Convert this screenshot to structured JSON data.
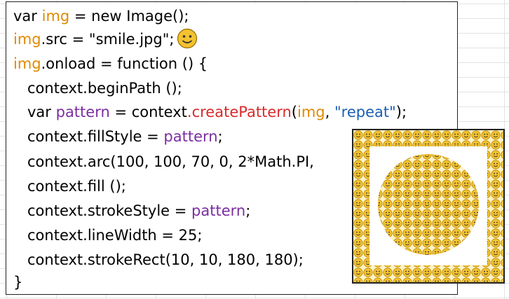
{
  "code_lines": [
    [
      {
        "text": "var ",
        "cls": ""
      },
      {
        "text": "img",
        "cls": "kw-orange"
      },
      {
        "text": " = new Image();",
        "cls": ""
      }
    ],
    [
      {
        "text": "img",
        "cls": "kw-orange"
      },
      {
        "text": ".src = \"smile.jpg\";",
        "cls": ""
      }
    ],
    [
      {
        "text": "img",
        "cls": "kw-orange"
      },
      {
        "text": ".onload = function () {",
        "cls": ""
      }
    ],
    [
      {
        "text": "context.beginPath ();",
        "cls": ""
      }
    ],
    [
      {
        "text": "var ",
        "cls": ""
      },
      {
        "text": "pattern",
        "cls": "kw-purple"
      },
      {
        "text": " = context",
        "cls": ""
      },
      {
        "text": ".",
        "cls": "dot-red"
      },
      {
        "text": "createPattern",
        "cls": "kw-red"
      },
      {
        "text": "(",
        "cls": ""
      },
      {
        "text": "img",
        "cls": "kw-orange"
      },
      {
        "text": ", ",
        "cls": ""
      },
      {
        "text": "\"repeat\"",
        "cls": "kw-blue"
      },
      {
        "text": ");",
        "cls": ""
      }
    ],
    [
      {
        "text": "context.fillStyle = ",
        "cls": ""
      },
      {
        "text": "pattern",
        "cls": "kw-purple"
      },
      {
        "text": ";",
        "cls": ""
      }
    ],
    [
      {
        "text": "context.arc(100, 100, 70, 0, 2*Math.PI,",
        "cls": ""
      }
    ],
    [
      {
        "text": "context.fill ();",
        "cls": ""
      }
    ],
    [
      {
        "text": "context.strokeStyle = ",
        "cls": ""
      },
      {
        "text": "pattern",
        "cls": "kw-purple"
      },
      {
        "text": ";",
        "cls": ""
      }
    ],
    [
      {
        "text": "context.lineWidth = 25;",
        "cls": ""
      }
    ],
    [
      {
        "text": "context.strokeRect(10, 10, 180, 180);",
        "cls": ""
      }
    ],
    [
      {
        "text": "}",
        "cls": ""
      }
    ]
  ],
  "indented_lines": [
    3,
    4,
    5,
    6,
    7,
    8,
    9,
    10
  ],
  "smiley_icon": "smiley-face-icon",
  "colors": {
    "variable_img": "#e08a00",
    "variable_pattern": "#7a2ea0",
    "method_name": "#d82a2a",
    "string_literal": "#1b5fb6",
    "smiley_fill": "#f2c230"
  }
}
